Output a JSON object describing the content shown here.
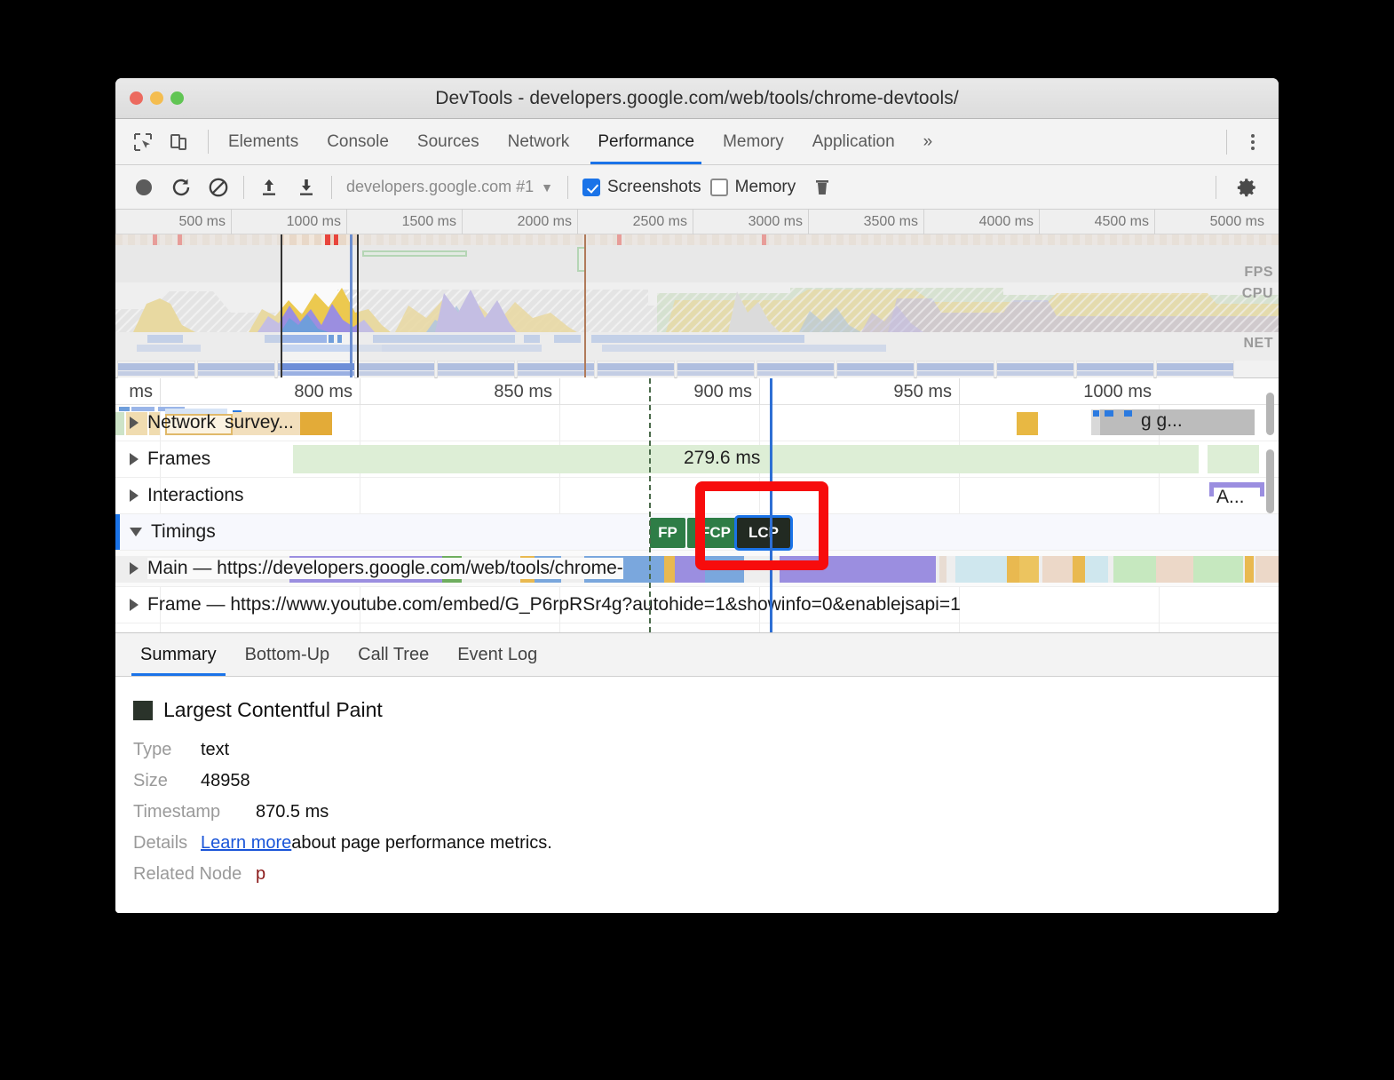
{
  "window": {
    "title": "DevTools - developers.google.com/web/tools/chrome-devtools/",
    "traffic": {
      "close": "close-button",
      "minimize": "minimize-button",
      "zoom": "zoom-button"
    }
  },
  "panel_tabs": [
    {
      "label": "Elements",
      "active": false
    },
    {
      "label": "Console",
      "active": false
    },
    {
      "label": "Sources",
      "active": false
    },
    {
      "label": "Network",
      "active": false
    },
    {
      "label": "Performance",
      "active": true
    },
    {
      "label": "Memory",
      "active": false
    },
    {
      "label": "Application",
      "active": false
    }
  ],
  "panel_tabs_overflow": "»",
  "toolbar": {
    "record_label": "record-button",
    "reload_label": "reload-and-record-button",
    "clear_label": "clear-button",
    "load_label": "load-profile-button",
    "save_label": "save-profile-button",
    "target_select": "developers.google.com #1",
    "target_caret": "▼",
    "screenshots_label": "Screenshots",
    "screenshots_checked": true,
    "memory_label": "Memory",
    "memory_checked": false,
    "trash_label": "collect-garbage-button",
    "settings_label": "settings-button"
  },
  "overview": {
    "ticks": [
      "500 ms",
      "1000 ms",
      "1500 ms",
      "2000 ms",
      "2500 ms",
      "3000 ms",
      "3500 ms",
      "4000 ms",
      "4500 ms",
      "5000 ms"
    ],
    "lane_labels": [
      "FPS",
      "CPU",
      "NET"
    ]
  },
  "timeline": {
    "ruler_ticks": [
      "ms",
      "800 ms",
      "850 ms",
      "900 ms",
      "950 ms",
      "1000 ms"
    ],
    "tracks": [
      {
        "name": "Network",
        "expanded": false,
        "arrow": "▶",
        "event_label": "survey...",
        "right_label": "g g..."
      },
      {
        "name": "Frames",
        "expanded": false,
        "arrow": "▶",
        "frame_duration": "279.6 ms"
      },
      {
        "name": "Interactions",
        "expanded": false,
        "arrow": "▶",
        "right_label": "A..."
      },
      {
        "name": "Timings",
        "expanded": true,
        "arrow": "▼",
        "selected": true
      },
      {
        "name": "Main — https://developers.google.com/web/tools/chrome-",
        "expanded": false,
        "arrow": "▶"
      },
      {
        "name": "Frame — https://www.youtube.com/embed/G_P6rpRSr4g?autohide=1&showinfo=0&enablejsapi=1",
        "expanded": false,
        "arrow": "▶"
      }
    ],
    "timing_markers": [
      {
        "label": "FP",
        "selected": false
      },
      {
        "label": "FCP",
        "selected": false
      },
      {
        "label": "LCP",
        "selected": true
      }
    ],
    "annotation": {
      "name": "red-highlight-box",
      "color": "#f70c0c"
    }
  },
  "detail_tabs": [
    {
      "label": "Summary",
      "active": true
    },
    {
      "label": "Bottom-Up",
      "active": false
    },
    {
      "label": "Call Tree",
      "active": false
    },
    {
      "label": "Event Log",
      "active": false
    }
  ],
  "summary": {
    "title": "Largest Contentful Paint",
    "swatch_color": "#2a332a",
    "rows": [
      {
        "key": "Type",
        "value": "text"
      },
      {
        "key": "Size",
        "value": "48958"
      },
      {
        "key": "Timestamp",
        "value": "870.5 ms"
      }
    ],
    "details_key": "Details",
    "details_link": "Learn more",
    "details_rest": " about page performance metrics.",
    "node_key": "Related Node",
    "node_value": "p"
  }
}
